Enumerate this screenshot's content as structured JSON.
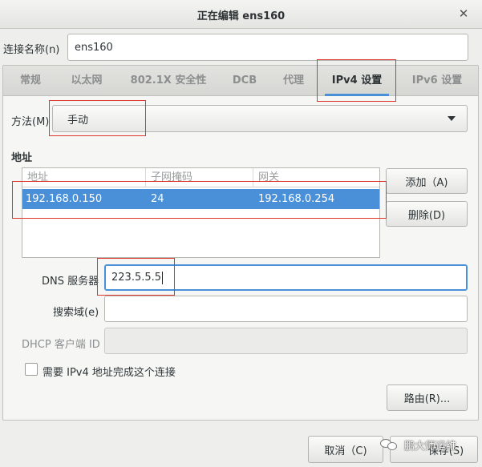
{
  "window": {
    "title": "正在编辑 ens160",
    "close_glyph": "✕"
  },
  "connection": {
    "label": "连接名称(n)",
    "value": "ens160"
  },
  "tabs": [
    {
      "label": "常规"
    },
    {
      "label": "以太网"
    },
    {
      "label": "802.1X 安全性"
    },
    {
      "label": "DCB"
    },
    {
      "label": "代理"
    },
    {
      "label": "IPv4 设置"
    },
    {
      "label": "IPv6 设置"
    }
  ],
  "active_tab": "IPv4 设置",
  "method": {
    "label": "方法(M)",
    "value": "手动"
  },
  "address_section": {
    "title": "地址",
    "columns": [
      "地址",
      "子网掩码",
      "网关"
    ],
    "rows": [
      {
        "address": "192.168.0.150",
        "netmask": "24",
        "gateway": "192.168.0.254"
      }
    ],
    "add_label": "添加（A)",
    "delete_label": "删除(D)"
  },
  "dns": {
    "label": "DNS 服务器",
    "value": "223.5.5.5"
  },
  "search_domain": {
    "label": "搜索域(e)",
    "value": ""
  },
  "dhcp_client_id": {
    "label": "DHCP 客户端 ID",
    "value": ""
  },
  "require_ipv4": {
    "label": "需要 IPv4 地址完成这个连接",
    "checked": false
  },
  "routes_label": "路由(R)...",
  "footer": {
    "cancel_label": "取消（C)",
    "save_label": "保存(S)"
  },
  "watermark": {
    "text": "鹏大师运维"
  },
  "colors": {
    "accent": "#4a90d9",
    "highlight_box": "#e0352b"
  }
}
